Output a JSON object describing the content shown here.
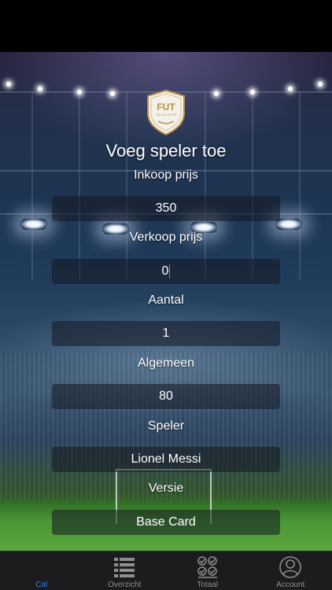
{
  "form": {
    "title": "Voeg speler toe",
    "purchase_label": "Inkoop prijs",
    "purchase_value": "350",
    "sale_label": "Verkoop prijs",
    "sale_value": "0",
    "quantity_label": "Aantal",
    "quantity_value": "1",
    "rating_label": "Algemeen",
    "rating_value": "80",
    "player_label": "Speler",
    "player_value": "Lionel Messi",
    "version_label": "Versie",
    "version_value": "Base Card"
  },
  "logo": {
    "text": "FUT",
    "subtext": "CALCULATOR"
  },
  "tabbar": {
    "tabs": [
      {
        "label": "Cal",
        "icon": "calculator-icon",
        "active": true
      },
      {
        "label": "Overzicht",
        "icon": "list-icon",
        "active": false
      },
      {
        "label": "Totaal",
        "icon": "checklist-icon",
        "active": false
      },
      {
        "label": "Account",
        "icon": "person-icon",
        "active": false
      }
    ]
  },
  "colors": {
    "accent": "#2f7cf6",
    "tabbar": "#1c1c1e",
    "logo_gold": "#b89146"
  }
}
